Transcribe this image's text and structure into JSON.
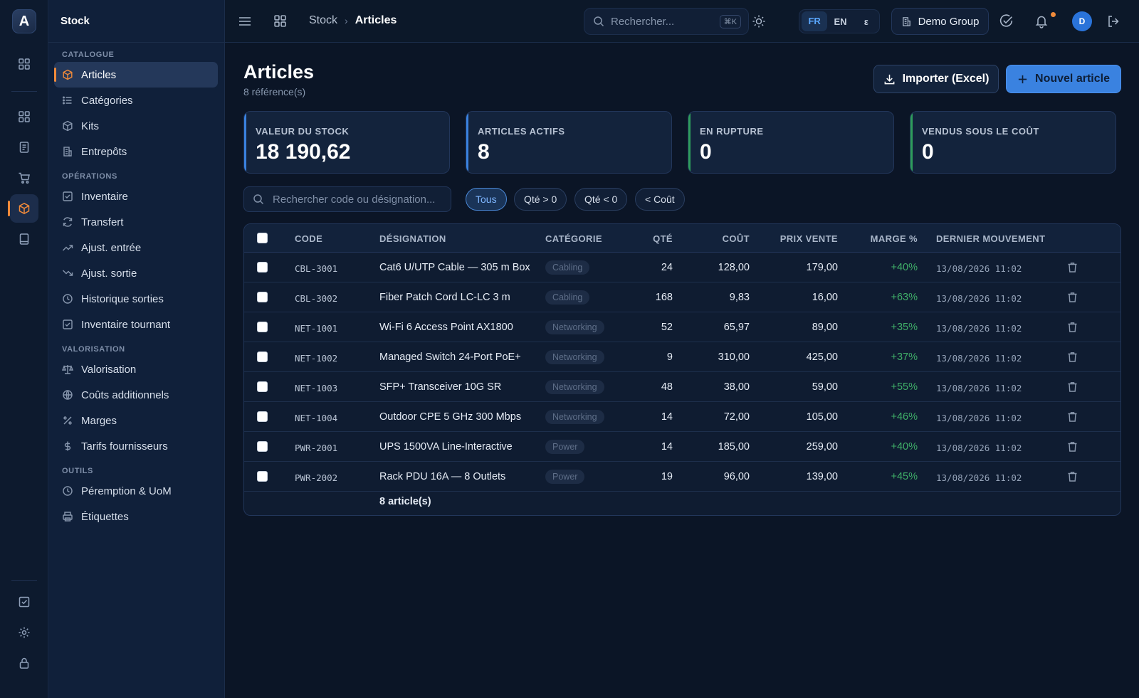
{
  "app": {
    "logo_letter": "A",
    "title": "Stock"
  },
  "sidebar": {
    "sections": [
      {
        "label": "CATALOGUE",
        "items": [
          {
            "label": "Articles",
            "icon": "box-icon",
            "active": true
          },
          {
            "label": "Catégories",
            "icon": "list-icon"
          },
          {
            "label": "Kits",
            "icon": "package-icon"
          },
          {
            "label": "Entrepôts",
            "icon": "building-icon"
          }
        ]
      },
      {
        "label": "OPÉRATIONS",
        "items": [
          {
            "label": "Inventaire",
            "icon": "checkbox-icon"
          },
          {
            "label": "Transfert",
            "icon": "refresh-icon"
          },
          {
            "label": "Ajust. entrée",
            "icon": "trend-up-icon"
          },
          {
            "label": "Ajust. sortie",
            "icon": "trend-down-icon"
          },
          {
            "label": "Historique sorties",
            "icon": "clock-icon"
          },
          {
            "label": "Inventaire tournant",
            "icon": "checkbox-icon"
          }
        ]
      },
      {
        "label": "VALORISATION",
        "items": [
          {
            "label": "Valorisation",
            "icon": "scale-icon"
          },
          {
            "label": "Coûts additionnels",
            "icon": "globe-icon"
          },
          {
            "label": "Marges",
            "icon": "percent-icon"
          },
          {
            "label": "Tarifs fournisseurs",
            "icon": "dollar-icon"
          }
        ]
      },
      {
        "label": "OUTILS",
        "items": [
          {
            "label": "Péremption & UoM",
            "icon": "clock-icon"
          },
          {
            "label": "Étiquettes",
            "icon": "printer-icon"
          }
        ]
      }
    ]
  },
  "topbar": {
    "breadcrumb": [
      "Stock",
      "Articles"
    ],
    "search_placeholder": "Rechercher...",
    "search_shortcut": "⌘K",
    "languages": [
      "FR",
      "EN",
      "ε"
    ],
    "active_language": "FR",
    "group": "Demo Group",
    "avatar_initial": "D"
  },
  "page": {
    "title": "Articles",
    "subtitle": "8 référence(s)",
    "import_label": "Importer (Excel)",
    "new_label": "Nouvel article"
  },
  "kpis": [
    {
      "label": "VALEUR DU STOCK",
      "value": "18 190,62",
      "accent": "#3a82e0"
    },
    {
      "label": "ARTICLES ACTIFS",
      "value": "8",
      "accent": "#3a82e0"
    },
    {
      "label": "EN RUPTURE",
      "value": "0",
      "accent": "#2e9d5b"
    },
    {
      "label": "VENDUS SOUS LE COÛT",
      "value": "0",
      "accent": "#2e9d5b"
    }
  ],
  "filters": {
    "search_placeholder": "Rechercher code ou désignation...",
    "chips": [
      "Tous",
      "Qté > 0",
      "Qté < 0",
      "< Coût"
    ],
    "active_chip": "Tous"
  },
  "table": {
    "columns": [
      "CODE",
      "DÉSIGNATION",
      "CATÉGORIE",
      "QTÉ",
      "COÛT",
      "PRIX VENTE",
      "MARGE %",
      "DERNIER MOUVEMENT"
    ],
    "rows": [
      {
        "code": "CBL-3001",
        "designation": "Cat6 U/UTP Cable — 305 m Box",
        "category": "Cabling",
        "qty": "24",
        "cost": "128,00",
        "price": "179,00",
        "margin": "+40%",
        "last_move": "13/08/2026 11:02"
      },
      {
        "code": "CBL-3002",
        "designation": "Fiber Patch Cord LC-LC 3 m",
        "category": "Cabling",
        "qty": "168",
        "cost": "9,83",
        "price": "16,00",
        "margin": "+63%",
        "last_move": "13/08/2026 11:02"
      },
      {
        "code": "NET-1001",
        "designation": "Wi-Fi 6 Access Point AX1800",
        "category": "Networking",
        "qty": "52",
        "cost": "65,97",
        "price": "89,00",
        "margin": "+35%",
        "last_move": "13/08/2026 11:02"
      },
      {
        "code": "NET-1002",
        "designation": "Managed Switch 24-Port PoE+",
        "category": "Networking",
        "qty": "9",
        "cost": "310,00",
        "price": "425,00",
        "margin": "+37%",
        "last_move": "13/08/2026 11:02"
      },
      {
        "code": "NET-1003",
        "designation": "SFP+ Transceiver 10G SR",
        "category": "Networking",
        "qty": "48",
        "cost": "38,00",
        "price": "59,00",
        "margin": "+55%",
        "last_move": "13/08/2026 11:02"
      },
      {
        "code": "NET-1004",
        "designation": "Outdoor CPE 5 GHz 300 Mbps",
        "category": "Networking",
        "qty": "14",
        "cost": "72,00",
        "price": "105,00",
        "margin": "+46%",
        "last_move": "13/08/2026 11:02"
      },
      {
        "code": "PWR-2001",
        "designation": "UPS 1500VA Line-Interactive",
        "category": "Power",
        "qty": "14",
        "cost": "185,00",
        "price": "259,00",
        "margin": "+40%",
        "last_move": "13/08/2026 11:02"
      },
      {
        "code": "PWR-2002",
        "designation": "Rack PDU 16A — 8 Outlets",
        "category": "Power",
        "qty": "19",
        "cost": "96,00",
        "price": "139,00",
        "margin": "+45%",
        "last_move": "13/08/2026 11:02"
      }
    ],
    "footer": "8 article(s)"
  }
}
